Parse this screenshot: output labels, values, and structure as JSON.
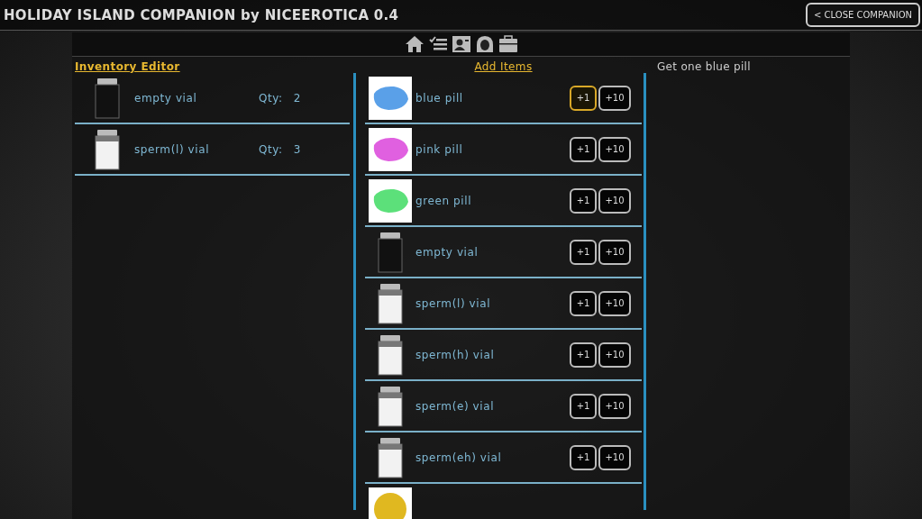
{
  "title_bar": {
    "title": "HOLIDAY ISLAND COMPANION by NICEEROTICA 0.4",
    "close_button": "< CLOSE COMPANION"
  },
  "nav_icons": [
    {
      "kind": "home"
    },
    {
      "kind": "checklist"
    },
    {
      "kind": "contacts"
    },
    {
      "kind": "profile"
    },
    {
      "kind": "inventory"
    }
  ],
  "inventory_editor": {
    "heading": "Inventory Editor",
    "items": [
      {
        "kind": "vial",
        "filled": false,
        "name": "empty vial",
        "qty_label": "Qty:",
        "qty": "2"
      },
      {
        "kind": "vial",
        "filled": true,
        "name": "sperm(l) vial",
        "qty_label": "Qty:",
        "qty": "3"
      }
    ]
  },
  "add_items": {
    "heading": "Add Items",
    "items": [
      {
        "kind": "pill",
        "color": "#5aa0e8",
        "name": "blue pill",
        "add_one": "+1",
        "add_ten": "+10",
        "focused": true
      },
      {
        "kind": "pill",
        "color": "#e060e0",
        "name": "pink pill",
        "add_one": "+1",
        "add_ten": "+10",
        "focused": false
      },
      {
        "kind": "pill",
        "color": "#5ce07a",
        "name": "green pill",
        "add_one": "+1",
        "add_ten": "+10",
        "focused": false
      },
      {
        "kind": "vial",
        "filled": false,
        "name": "empty vial",
        "add_one": "+1",
        "add_ten": "+10",
        "focused": false
      },
      {
        "kind": "vial",
        "filled": true,
        "name": "sperm(l) vial",
        "add_one": "+1",
        "add_ten": "+10",
        "focused": false
      },
      {
        "kind": "vial",
        "filled": true,
        "name": "sperm(h) vial",
        "add_one": "+1",
        "add_ten": "+10",
        "focused": false
      },
      {
        "kind": "vial",
        "filled": true,
        "name": "sperm(e) vial",
        "add_one": "+1",
        "add_ten": "+10",
        "focused": false
      },
      {
        "kind": "vial",
        "filled": true,
        "name": "sperm(eh) vial",
        "add_one": "+1",
        "add_ten": "+10",
        "focused": false
      },
      {
        "kind": "ball",
        "color": "#e0b820"
      }
    ]
  },
  "description": "Get one blue pill"
}
